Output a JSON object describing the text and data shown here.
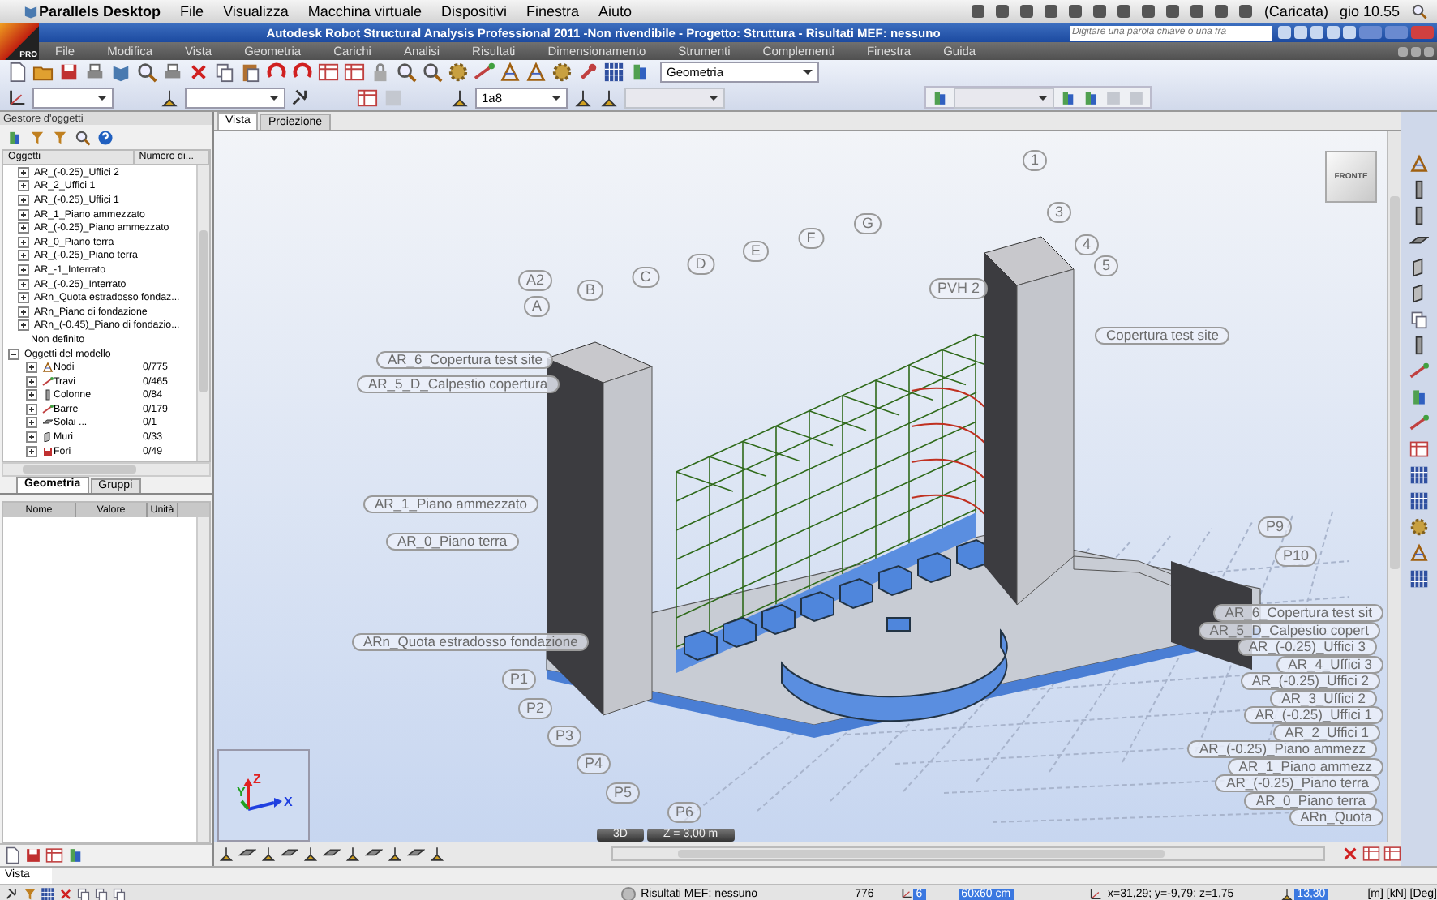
{
  "mac_menubar": {
    "menus": [
      "Parallels Desktop",
      "File",
      "Visualizza",
      "Macchina virtuale",
      "Dispositivi",
      "Finestra",
      "Aiuto"
    ],
    "battery": "(Caricata)",
    "clock": "gio 10.55"
  },
  "window": {
    "title": "Autodesk Robot Structural Analysis Professional 2011 -Non rivendibile - Progetto: Struttura - Risultati MEF: nessuno",
    "logo_badge": "PRO",
    "help_search": {
      "placeholder": "Digitare una parola chiave o una fra"
    }
  },
  "menubar": [
    "File",
    "Modifica",
    "Vista",
    "Geometria",
    "Carichi",
    "Analisi",
    "Risultati",
    "Dimensionamento",
    "Strumenti",
    "Complementi",
    "Finestra",
    "Guida"
  ],
  "toolbar": {
    "layout_dropdown": "Geometria",
    "scale_dropdown": "1a8"
  },
  "object_inspector": {
    "title": "Gestore d'oggetti",
    "columns": [
      "Oggetti",
      "Numero di..."
    ],
    "levels": [
      {
        "label": "AR_(-0.25)_Uffici 2",
        "expanded": false
      },
      {
        "label": "AR_2_Uffici 1",
        "expanded": false
      },
      {
        "label": "AR_(-0.25)_Uffici 1",
        "expanded": false
      },
      {
        "label": "AR_1_Piano ammezzato",
        "expanded": false
      },
      {
        "label": "AR_(-0.25)_Piano ammezzato",
        "expanded": false
      },
      {
        "label": "AR_0_Piano terra",
        "expanded": false
      },
      {
        "label": "AR_(-0.25)_Piano terra",
        "expanded": false
      },
      {
        "label": "AR_-1_Interrato",
        "expanded": false
      },
      {
        "label": "AR_(-0.25)_Interrato",
        "expanded": false
      },
      {
        "label": "ARn_Quota estradosso fondaz...",
        "expanded": false
      },
      {
        "label": "ARn_Piano di fondazione",
        "expanded": false
      },
      {
        "label": "ARn_(-0.45)_Piano di fondazio...",
        "expanded": false
      },
      {
        "label": "Non definito"
      }
    ],
    "model_objects": {
      "label": "Oggetti del modello",
      "expanded": true,
      "children": [
        {
          "label": "Nodi",
          "count": "0/775",
          "expanded": false
        },
        {
          "label": "Travi",
          "count": "0/465",
          "expanded": false
        },
        {
          "label": "Colonne",
          "count": "0/84",
          "expanded": false
        },
        {
          "label": "Barre",
          "count": "0/179",
          "expanded": false
        },
        {
          "label": "Solai ...",
          "count": "0/1",
          "expanded": false
        },
        {
          "label": "Muri",
          "count": "0/33",
          "expanded": false
        },
        {
          "label": "Fori",
          "count": "0/49",
          "expanded": false
        }
      ]
    },
    "tabs": [
      {
        "label": "Geometria",
        "selected": true
      },
      {
        "label": "Gruppi",
        "selected": false
      }
    ],
    "properties_columns": [
      "Nome",
      "Valore",
      "Unità"
    ]
  },
  "view": {
    "tabs": [
      {
        "label": "Vista",
        "selected": true
      },
      {
        "label": "Proiezione",
        "selected": false
      }
    ],
    "view_cube": "FRONTE",
    "axes": [
      "X",
      "Y",
      "Z"
    ],
    "grid_labels": [
      "A2",
      "A",
      "B",
      "C",
      "D",
      "E",
      "F",
      "G",
      "1",
      "3",
      "4",
      "5",
      "PVH 2",
      "P1",
      "P2",
      "P3",
      "P4",
      "P5",
      "P6",
      "P9",
      "P10"
    ],
    "level_labels_left": [
      "AR_6_Copertura test site",
      "AR_5_D_Calpestio copertura",
      "AR_1_Piano ammezzato",
      "AR_0_Piano terra",
      "ARn_Quota estradosso fondazione"
    ],
    "level_label_tower": "Copertura test site",
    "level_labels_right": [
      "AR_6_Copertura test sit",
      "AR_5_D_Calpestio copert",
      "AR_(-0.25)_Uffici 3",
      "AR_4_Uffici 3",
      "AR_(-0.25)_Uffici 2",
      "AR_3_Uffici 2",
      "AR_(-0.25)_Uffici 1",
      "AR_2_Uffici 1",
      "AR_(-0.25)_Piano ammezz",
      "AR_1_Piano ammezz",
      "AR_(-0.25)_Piano terra",
      "AR_0_Piano terra",
      "ARn_Quota"
    ],
    "mode": "3D",
    "elevation": "Z = 3,00 m"
  },
  "bottom_tab": "Vista",
  "status_bar": {
    "results": "Risultati MEF: nessuno",
    "nodes": "776",
    "case": "6",
    "section": "60x60 cm",
    "coordinates": "x=31,29; y=-9,79; z=1,75",
    "angle": "13,30",
    "units": "[m] [kN] [Deg]"
  }
}
